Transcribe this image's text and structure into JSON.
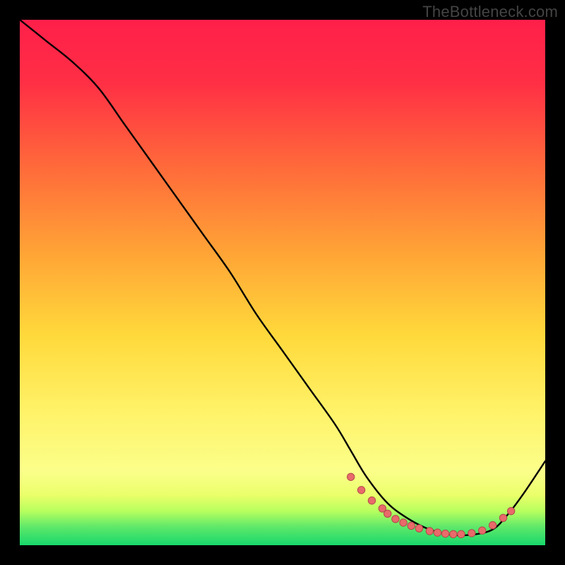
{
  "watermark": "TheBottleneck.com",
  "colors": {
    "frame": "#000000",
    "label": "#444444",
    "curve_stroke": "#000000",
    "dot_fill": "#e96a6a",
    "dot_stroke": "#b24a4a",
    "gradient_top": "#ff1f4a",
    "gradient_mid": "#ffd93b",
    "gradient_low": "#b7ff5e",
    "gradient_bottom": "#17d86b"
  },
  "chart_data": {
    "type": "line",
    "title": "",
    "xlabel": "",
    "ylabel": "",
    "xlim": [
      0,
      100
    ],
    "ylim": [
      0,
      100
    ],
    "note": "Axes are hidden in the source image; x/y are normalized percentages read from pixel positions.",
    "series": [
      {
        "name": "curve",
        "x": [
          0,
          5,
          10,
          15,
          20,
          25,
          30,
          35,
          40,
          45,
          50,
          55,
          60,
          63,
          66,
          70,
          74,
          78,
          82,
          86,
          90,
          93,
          96,
          100
        ],
        "y": [
          100,
          96,
          92,
          87,
          80,
          73,
          66,
          59,
          52,
          44,
          37,
          30,
          23,
          18,
          13,
          8,
          5,
          3,
          2,
          2,
          3,
          6,
          10,
          16
        ]
      }
    ],
    "dots": {
      "name": "highlight-points",
      "x": [
        63,
        65,
        67,
        69,
        70,
        71.5,
        73,
        74.5,
        76,
        78,
        79.5,
        81,
        82.5,
        84,
        86,
        88,
        90,
        92,
        93.5
      ],
      "y": [
        13,
        10.5,
        8.5,
        7,
        6,
        5,
        4.3,
        3.7,
        3.2,
        2.7,
        2.4,
        2.2,
        2.1,
        2.1,
        2.3,
        2.8,
        3.8,
        5.2,
        6.5
      ]
    },
    "background_gradient_bands": [
      {
        "from_y": 0,
        "to_y": 4,
        "color": "#17d86b"
      },
      {
        "from_y": 4,
        "to_y": 9,
        "color": "#b7ff5e"
      },
      {
        "from_y": 9,
        "to_y": 14,
        "color": "#eaff6a"
      },
      {
        "from_y": 14,
        "to_y": 55,
        "color": "#ffd93b"
      },
      {
        "from_y": 55,
        "to_y": 100,
        "color": "#ff1f4a"
      }
    ]
  }
}
